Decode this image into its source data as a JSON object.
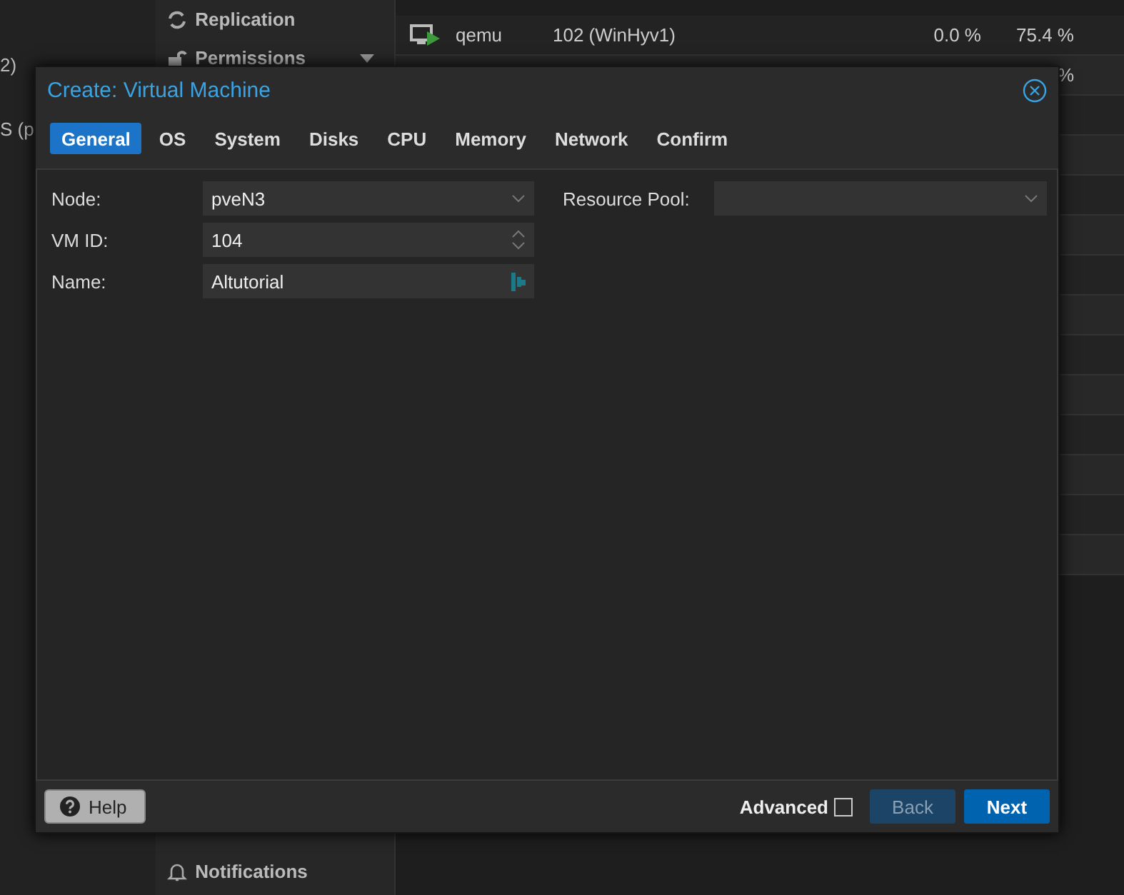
{
  "background": {
    "left_fragments": [
      "2)",
      "S (p"
    ],
    "sidebar_items": [
      {
        "label": "Replication",
        "kind": "replication",
        "expandable": false
      },
      {
        "label": "Permissions",
        "kind": "lock",
        "expandable": true
      },
      {
        "label": "Notifications",
        "kind": "bell",
        "expandable": false
      }
    ],
    "table_rows": [
      {
        "type": "qemu",
        "name": "102 (WinHyv1)",
        "cpu": "0.0 %",
        "memory": "75.4 %"
      },
      {
        "memory": "%"
      }
    ]
  },
  "dialog": {
    "title": "Create: Virtual Machine",
    "tabs": [
      {
        "label": "General",
        "selected": true
      },
      {
        "label": "OS",
        "selected": false
      },
      {
        "label": "System",
        "selected": false
      },
      {
        "label": "Disks",
        "selected": false
      },
      {
        "label": "CPU",
        "selected": false
      },
      {
        "label": "Memory",
        "selected": false
      },
      {
        "label": "Network",
        "selected": false
      },
      {
        "label": "Confirm",
        "selected": false
      }
    ],
    "fields": [
      {
        "label": "Node:",
        "value": "pveN3",
        "kind": "select"
      },
      {
        "label": "VM ID:",
        "value": "104",
        "kind": "spinner"
      },
      {
        "label": "Name:",
        "value": "Altutorial",
        "kind": "text"
      }
    ],
    "resource_pool": {
      "label": "Resource Pool:",
      "kind": "select"
    },
    "footer": {
      "help": "Help",
      "advanced": {
        "label": "Advanced",
        "checked": false
      },
      "back": {
        "label": "Back",
        "disabled": true
      },
      "next": {
        "label": "Next",
        "disabled": false
      }
    }
  }
}
